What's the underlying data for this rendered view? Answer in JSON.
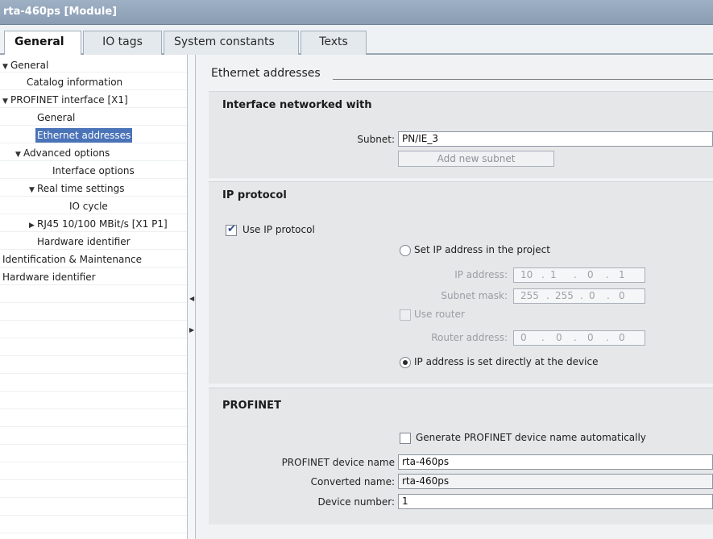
{
  "window": {
    "title": "rta-460ps [Module]"
  },
  "tabs": [
    {
      "label": "General"
    },
    {
      "label": "IO tags"
    },
    {
      "label": "System constants"
    },
    {
      "label": "Texts"
    }
  ],
  "tree": {
    "items": [
      {
        "label": "General"
      },
      {
        "label": "Catalog information"
      },
      {
        "label": "PROFINET interface [X1]"
      },
      {
        "label": "General"
      },
      {
        "label": "Ethernet addresses"
      },
      {
        "label": "Advanced options"
      },
      {
        "label": "Interface options"
      },
      {
        "label": "Real time settings"
      },
      {
        "label": "IO cycle"
      },
      {
        "label": "RJ45 10/100 MBit/s [X1 P1]"
      },
      {
        "label": "Hardware identifier"
      },
      {
        "label": "Identification & Maintenance"
      },
      {
        "label": "Hardware identifier"
      }
    ],
    "selected_index": 4
  },
  "section": {
    "title": "Ethernet addresses"
  },
  "interface_panel": {
    "title": "Interface networked with",
    "subnet_label": "Subnet:",
    "subnet_value": "PN/IE_3",
    "add_subnet_label": "Add new subnet"
  },
  "ip_panel": {
    "title": "IP protocol",
    "use_ip_label": "Use IP protocol",
    "use_ip_checked": true,
    "set_ip_label": "Set IP address in the project",
    "ip_address_label": "IP address:",
    "ip_address": [
      "10",
      "1",
      "0",
      "1"
    ],
    "subnet_mask_label": "Subnet mask:",
    "subnet_mask": [
      "255",
      "255",
      "0",
      "0"
    ],
    "use_router_label": "Use router",
    "router_address_label": "Router address:",
    "router_address": [
      "0",
      "0",
      "0",
      "0"
    ],
    "ip_direct_label": "IP address is set directly at the device",
    "selected_option": "ip_direct"
  },
  "profinet_panel": {
    "title": "PROFINET",
    "generate_name_label": "Generate PROFINET device name automatically",
    "generate_name_checked": false,
    "device_name_label": "PROFINET device name",
    "device_name": "rta-460ps",
    "converted_name_label": "Converted name:",
    "converted_name": "rta-460ps",
    "device_number_label": "Device number:",
    "device_number": "1"
  }
}
